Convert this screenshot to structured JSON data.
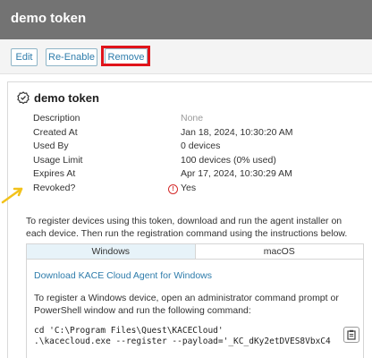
{
  "header": {
    "title": "demo token"
  },
  "toolbar": {
    "edit_label": "Edit",
    "reenable_label": "Re-Enable",
    "remove_label": "Remove"
  },
  "card": {
    "title": "demo token",
    "properties": [
      {
        "label": "Description",
        "value": "None"
      },
      {
        "label": "Created At",
        "value": "Jan 18, 2024, 10:30:20 AM"
      },
      {
        "label": "Used By",
        "value": "0 devices"
      },
      {
        "label": "Usage Limit",
        "value": "100 devices (0% used)"
      },
      {
        "label": "Expires At",
        "value": "Apr 17, 2024, 10:30:29 AM"
      },
      {
        "label": "Revoked?",
        "value": "Yes"
      }
    ]
  },
  "instructions": "To register devices using this token, download and run the agent installer on each device. Then run the registration command using the instructions below.",
  "tabs": [
    {
      "label": "Windows"
    },
    {
      "label": "macOS"
    }
  ],
  "windows_panel": {
    "download_link": "Download KACE Cloud Agent for Windows",
    "register_text": "To register a Windows device, open an administrator command prompt or PowerShell window and run the following command:",
    "code_line1": "cd 'C:\\Program Files\\Quest\\KACECloud'",
    "code_line2": ".\\kacecloud.exe --register --payload='_KC_dKy2etDVES8VbxC4"
  },
  "colors": {
    "header_bg": "#737373",
    "link": "#2e7cab",
    "highlight": "#e0141b",
    "warning": "#d42a2a",
    "arrow": "#f2c21b"
  }
}
